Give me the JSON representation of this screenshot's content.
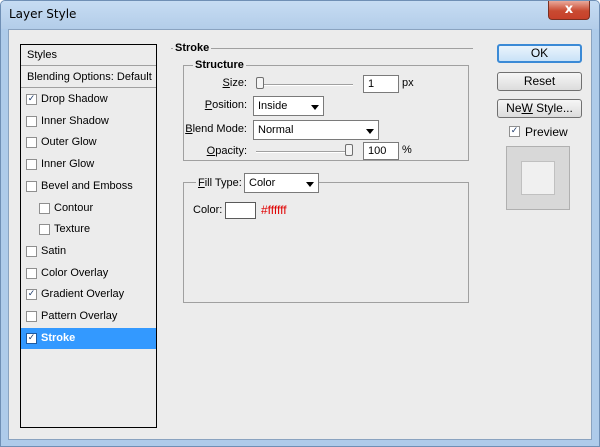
{
  "window": {
    "title": "Layer Style",
    "close_symbol": "x"
  },
  "styles_list": {
    "header": "Styles",
    "blending_options": "Blending Options: Default",
    "items": [
      {
        "label": "Drop Shadow",
        "checked": true,
        "selected": false,
        "indent": false
      },
      {
        "label": "Inner Shadow",
        "checked": false,
        "selected": false,
        "indent": false
      },
      {
        "label": "Outer Glow",
        "checked": false,
        "selected": false,
        "indent": false
      },
      {
        "label": "Inner Glow",
        "checked": false,
        "selected": false,
        "indent": false
      },
      {
        "label": "Bevel and Emboss",
        "checked": false,
        "selected": false,
        "indent": false
      },
      {
        "label": "Contour",
        "checked": false,
        "selected": false,
        "indent": true
      },
      {
        "label": "Texture",
        "checked": false,
        "selected": false,
        "indent": true
      },
      {
        "label": "Satin",
        "checked": false,
        "selected": false,
        "indent": false
      },
      {
        "label": "Color Overlay",
        "checked": false,
        "selected": false,
        "indent": false
      },
      {
        "label": "Gradient Overlay",
        "checked": true,
        "selected": false,
        "indent": false
      },
      {
        "label": "Pattern Overlay",
        "checked": false,
        "selected": false,
        "indent": false
      },
      {
        "label": "Stroke",
        "checked": true,
        "selected": true,
        "indent": false
      }
    ]
  },
  "stroke": {
    "title": "Stroke",
    "structure_title": "Structure",
    "size": {
      "label_u": "S",
      "label_rest": "ize:",
      "value": "1",
      "unit": "px",
      "slider_fraction": 0
    },
    "position": {
      "label_u": "P",
      "label_rest": "osition:",
      "value": "Inside"
    },
    "blend_mode": {
      "label_u": "B",
      "label_rest": "lend Mode:",
      "value": "Normal"
    },
    "opacity": {
      "label_u": "O",
      "label_rest": "pacity:",
      "value": "100",
      "unit": "%",
      "slider_fraction": 1
    },
    "fill_type": {
      "label_u": "F",
      "label_rest": "ill Type:",
      "value": "Color"
    },
    "color": {
      "label": "Color:",
      "swatch": "#ffffff",
      "hex_text": "#ffffff",
      "hex_color": "#e00000"
    }
  },
  "buttons": {
    "ok": "OK",
    "reset": "Reset",
    "new_style_u": "W",
    "new_style_pre": "Ne",
    "new_style_post": " Style..."
  },
  "preview": {
    "label": "Preview",
    "checked": true
  },
  "colors": {
    "title_bar": "#b3cde9",
    "selection": "#3399ff",
    "dialog_bg": "#ececec"
  }
}
